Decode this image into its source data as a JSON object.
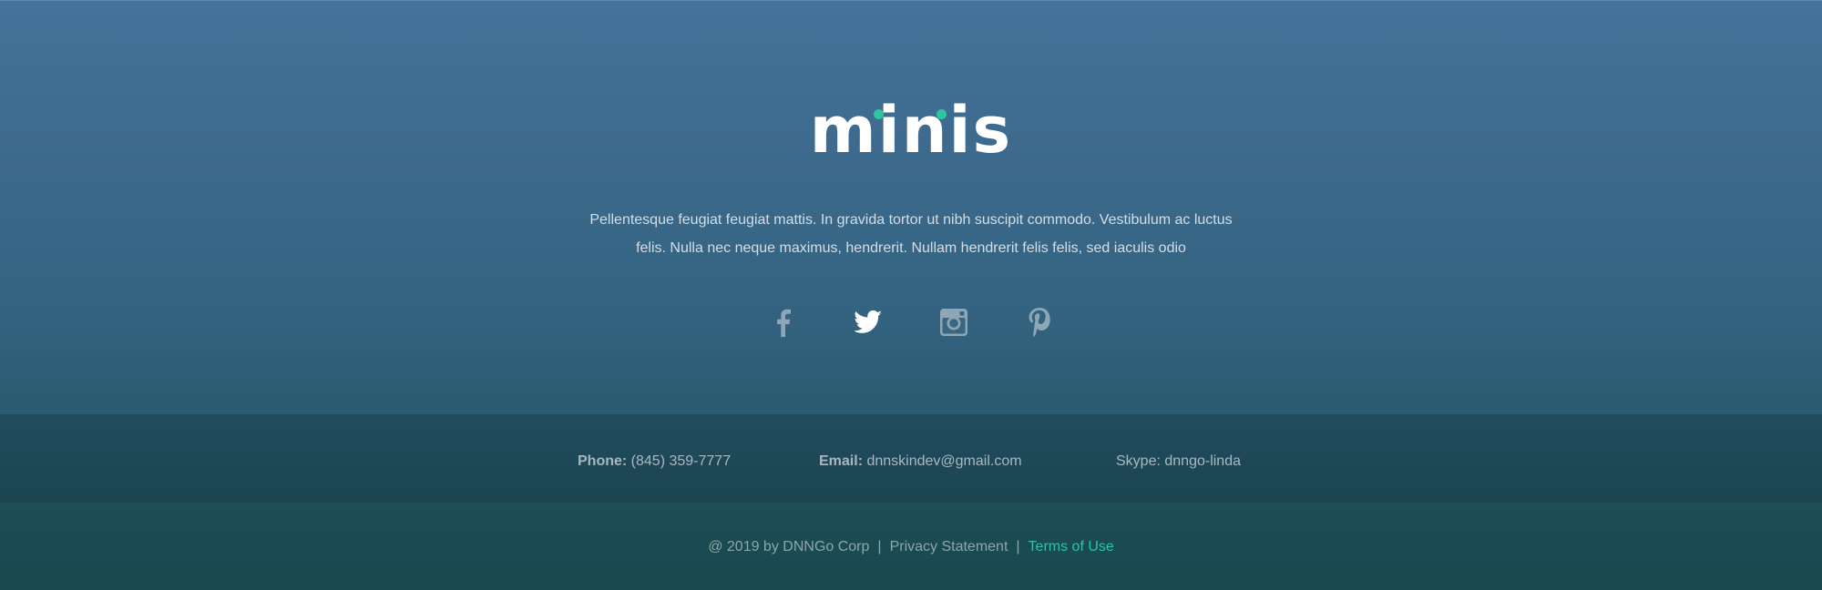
{
  "brand": {
    "logo_text": "minis",
    "accent_color": "#2ec4a0"
  },
  "about": {
    "description": "Pellentesque feugiat feugiat mattis. In gravida tortor ut nibh suscipit commodo. Vestibulum ac luctus felis. Nulla nec neque maximus, hendrerit. Nullam hendrerit felis felis, sed iaculis odio"
  },
  "social": [
    {
      "name": "facebook-icon",
      "active": false
    },
    {
      "name": "twitter-icon",
      "active": true
    },
    {
      "name": "instagram-icon",
      "active": false
    },
    {
      "name": "pinterest-icon",
      "active": false
    }
  ],
  "contact": {
    "phone_label": "Phone:",
    "phone_value": "(845) 359-7777",
    "email_label": "Email:",
    "email_value": "dnnskindev@gmail.com",
    "skype_label": "Skype:",
    "skype_value": "dnngo-linda"
  },
  "footer": {
    "copyright": "@ 2019 by DNNGo Corp",
    "separator": "|",
    "privacy": "Privacy Statement",
    "terms": "Terms of Use",
    "terms_color": "#25c7a5"
  }
}
